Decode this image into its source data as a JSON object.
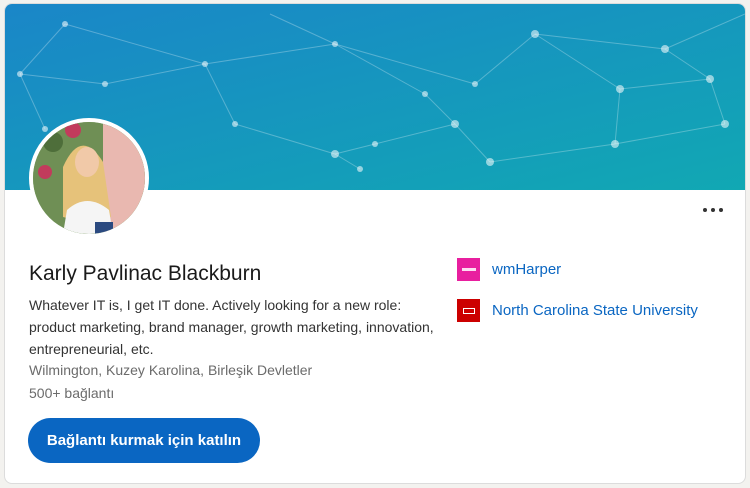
{
  "profile": {
    "name": "Karly Pavlinac Blackburn",
    "headline": "Whatever IT is, I get IT done. Actively looking for a new role: product marketing, brand manager, growth marketing, innovation, entrepreneurial, etc.",
    "location": "Wilmington, Kuzey Karolina, Birleşik Devletler",
    "connections": "500+ bağlantı"
  },
  "actions": {
    "connect_label": "Bağlantı kurmak için katılın",
    "more_icon": "more-horizontal-icon"
  },
  "organizations": [
    {
      "name": "wmHarper",
      "logo_color": "#e81f9f"
    },
    {
      "name": "North Carolina State University",
      "logo_color": "#cc0000"
    }
  ],
  "colors": {
    "accent": "#0a66c2",
    "banner_start": "#1a86c8",
    "banner_end": "#14a7b5"
  }
}
